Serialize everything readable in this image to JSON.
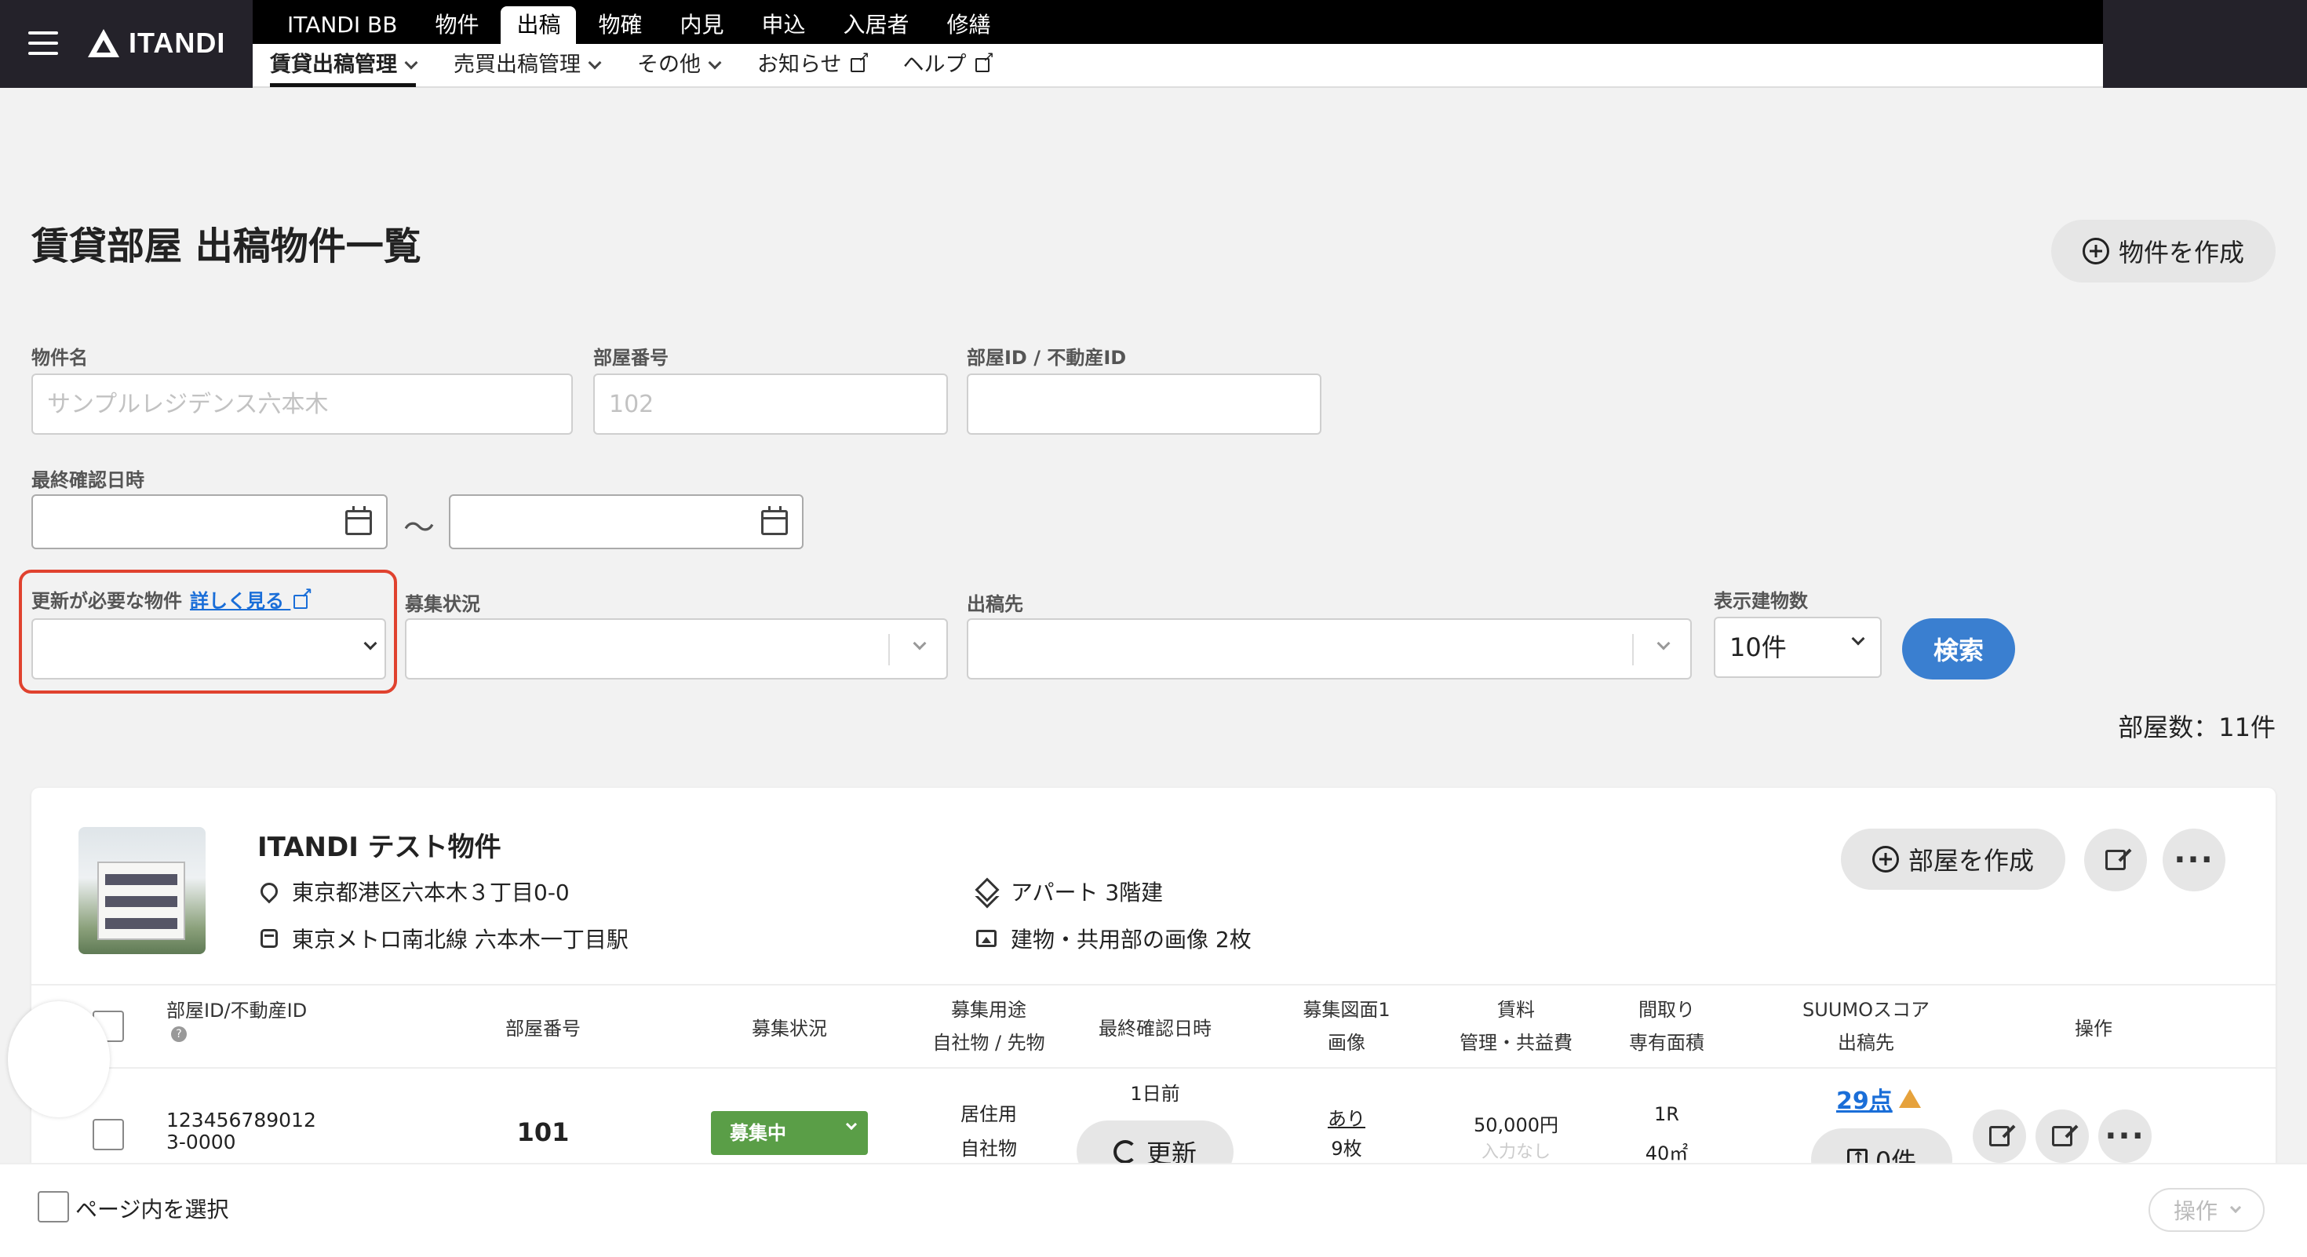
{
  "header": {
    "logo_text": "ITANDI",
    "main_tabs": [
      "ITANDI BB",
      "物件",
      "出稿",
      "物確",
      "内見",
      "申込",
      "入居者",
      "修繕"
    ],
    "active_main_tab": "出稿",
    "sub_tabs": [
      {
        "label": "賃貸出稿管理",
        "type": "dropdown"
      },
      {
        "label": "売買出稿管理",
        "type": "dropdown"
      },
      {
        "label": "その他",
        "type": "dropdown"
      },
      {
        "label": "お知らせ",
        "type": "external"
      },
      {
        "label": "ヘルプ",
        "type": "external"
      }
    ]
  },
  "page": {
    "title": "賃貸部屋 出稿物件一覧",
    "create_property_label": "物件を作成",
    "room_count_text": "部屋数：11件"
  },
  "filters": {
    "property_name": {
      "label": "物件名",
      "placeholder": "サンプルレジデンス六本木"
    },
    "room_number": {
      "label": "部屋番号",
      "placeholder": "102"
    },
    "room_id": {
      "label": "部屋ID / 不動産ID",
      "placeholder": ""
    },
    "last_confirmed": {
      "label": "最終確認日時",
      "separator": "〜"
    },
    "needs_update": {
      "label": "更新が必要な物件",
      "link": "詳しく見る"
    },
    "recruit_status": {
      "label": "募集状況"
    },
    "publish_dest": {
      "label": "出稿先"
    },
    "display_count": {
      "label": "表示建物数",
      "value": "10件"
    },
    "search_label": "検索"
  },
  "property": {
    "name": "ITANDI テスト物件",
    "address": "東京都港区六本木３丁目0-0",
    "station": "東京メトロ南北線 六本木一丁目駅",
    "building_type": "アパート 3階建",
    "images": "建物・共用部の画像 2枚",
    "create_room_label": "部屋を作成"
  },
  "table": {
    "headers": {
      "room_id": "部屋ID/不動産ID",
      "room_number": "部屋番号",
      "status": "募集状況",
      "usage_1": "募集用途",
      "usage_2": "自社物 / 先物",
      "last_confirmed": "最終確認日時",
      "floor_plan_1": "募集図面1",
      "floor_plan_2": "画像",
      "rent_1": "賃料",
      "rent_2": "管理・共益費",
      "layout_1": "間取り",
      "layout_2": "専有面積",
      "suumo_1": "SUUMOスコア",
      "suumo_2": "出稿先",
      "ops": "操作"
    },
    "row": {
      "room_id": "123456789012 3-0000",
      "room_number": "101",
      "status": "募集中",
      "usage": "居住用",
      "ownership": "自社物",
      "last_confirmed_ago": "1日前",
      "update_label": "更新",
      "floor_plan_link": "あり",
      "image_count": "9枚",
      "rent": "50,000円",
      "management_fee": "入力なし",
      "layout": "1R",
      "area": "40㎡",
      "suumo_score": "29点",
      "publish_count": "0件"
    }
  },
  "footer": {
    "select_page_label": "ページ内を選択",
    "ops_label": "操作"
  },
  "colors": {
    "header_bg": "#24222a",
    "accent_blue": "#3a7fd0",
    "status_green": "#5a9e47",
    "highlight_red": "#e0422f",
    "warning_orange": "#e6a23c"
  }
}
